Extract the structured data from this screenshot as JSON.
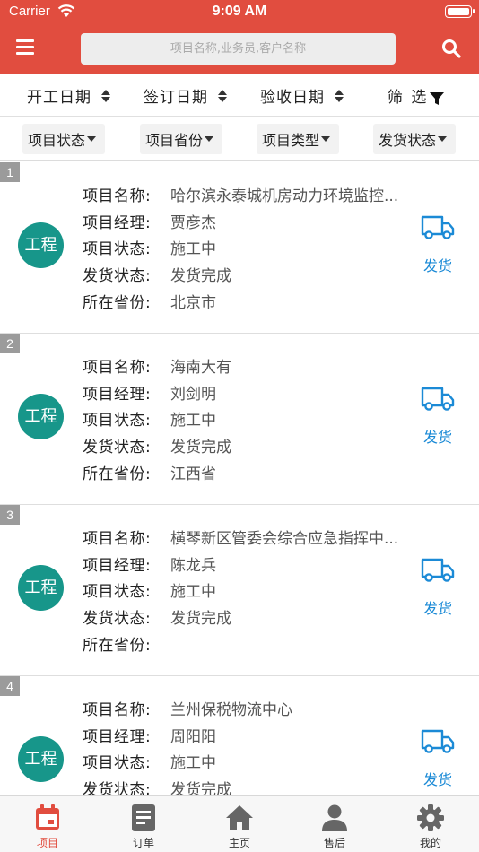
{
  "status_bar": {
    "carrier": "Carrier",
    "time": "9:09 AM"
  },
  "header": {
    "search_placeholder": "项目名称,业务员,客户名称"
  },
  "sort_bar": {
    "items": [
      {
        "label": "开工日期"
      },
      {
        "label": "签订日期"
      },
      {
        "label": "验收日期"
      },
      {
        "label": "筛 选"
      }
    ]
  },
  "filter_bar": {
    "items": [
      {
        "label": "项目状态"
      },
      {
        "label": "项目省份"
      },
      {
        "label": "项目类型"
      },
      {
        "label": "发货状态"
      }
    ]
  },
  "field_labels": {
    "name": "项目名称:",
    "manager": "项目经理:",
    "status": "项目状态:",
    "delivery": "发货状态:",
    "province": "所在省份:"
  },
  "projects": [
    {
      "index": "1",
      "type": "工程",
      "name": "哈尔滨永泰城机房动力环境监控...",
      "manager": "贾彦杰",
      "status": "施工中",
      "delivery": "发货完成",
      "province": "北京市",
      "action": "发货"
    },
    {
      "index": "2",
      "type": "工程",
      "name": "海南大有",
      "manager": "刘剑明",
      "status": "施工中",
      "delivery": "发货完成",
      "province": "江西省",
      "action": "发货"
    },
    {
      "index": "3",
      "type": "工程",
      "name": "横琴新区管委会综合应急指挥中...",
      "manager": "陈龙兵",
      "status": "施工中",
      "delivery": "发货完成",
      "province": "",
      "action": "发货"
    },
    {
      "index": "4",
      "type": "工程",
      "name": "兰州保税物流中心",
      "manager": "周阳阳",
      "status": "施工中",
      "delivery": "发货完成",
      "province": "",
      "action": "发货"
    }
  ],
  "tab_bar": {
    "active": "项目",
    "items": [
      {
        "label": "项目",
        "icon": "calendar-icon"
      },
      {
        "label": "订单",
        "icon": "document-icon"
      },
      {
        "label": "主页",
        "icon": "home-icon"
      },
      {
        "label": "售后",
        "icon": "person-icon"
      },
      {
        "label": "我的",
        "icon": "gear-icon"
      }
    ]
  },
  "colors": {
    "brand": "#e14d3f",
    "badge": "#17968a",
    "ship_blue": "#1b8ad6"
  }
}
